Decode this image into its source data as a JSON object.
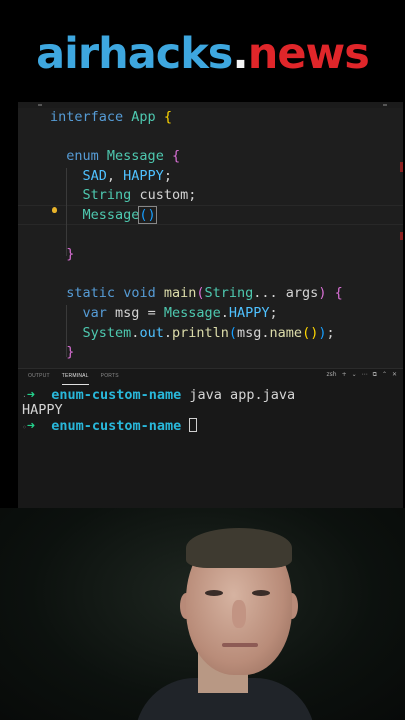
{
  "brand": {
    "part1": "airhacks",
    "dot": ".",
    "part2": "news"
  },
  "editor": {
    "lines": [
      {
        "type": "interface"
      },
      {
        "type": "blank"
      },
      {
        "type": "enum"
      },
      {
        "type": "values"
      },
      {
        "type": "field"
      },
      {
        "type": "ctor"
      },
      {
        "type": "blank"
      },
      {
        "type": "close"
      },
      {
        "type": "blank"
      },
      {
        "type": "main"
      },
      {
        "type": "var"
      },
      {
        "type": "println"
      },
      {
        "type": "close"
      }
    ],
    "tokens": {
      "interface_kw": "interface",
      "app": "App",
      "enum_kw": "enum",
      "message": "Message",
      "sad": "SAD",
      "happy": "HAPPY",
      "string": "String",
      "custom": "custom",
      "static_kw": "static",
      "void_kw": "void",
      "main": "main",
      "args": "args",
      "var_kw": "var",
      "msg": "msg",
      "system": "System",
      "out": "out",
      "println": "println",
      "name": "name"
    }
  },
  "panel": {
    "tabs": [
      "OUTPUT",
      "TERMINAL",
      "PORTS"
    ],
    "active_tab": "TERMINAL",
    "actions": [
      "zsh",
      "+",
      "⌄",
      "⋯",
      "⧉",
      "⌃",
      "✕"
    ]
  },
  "terminal": {
    "prompt_arrow": "➜",
    "dir": "enum-custom-name",
    "command": "java app.java",
    "output": "HAPPY"
  },
  "colors": {
    "brand_blue": "#3ea7df",
    "brand_red": "#e0262a",
    "editor_bg": "#1e1e1e",
    "keyword": "#569cd6",
    "type": "#4ec9b0",
    "prompt_green": "#23d18b"
  }
}
